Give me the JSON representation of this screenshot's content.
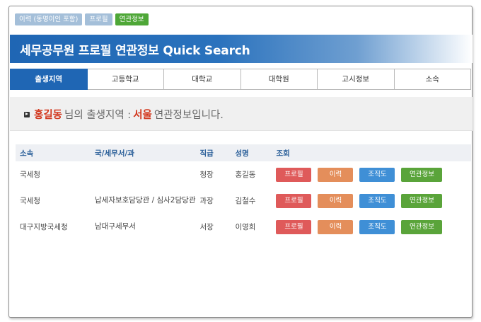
{
  "top_tags": {
    "history": "이력 (동명이인 포함)",
    "profile": "프로필",
    "related": "연관정보"
  },
  "banner": {
    "title": "세무공무원 프로필 연관정보 Quick Search"
  },
  "tabs": [
    {
      "label": "출생지역",
      "active": true
    },
    {
      "label": "고등학교"
    },
    {
      "label": "대학교"
    },
    {
      "label": "대학원"
    },
    {
      "label": "고시정보"
    },
    {
      "label": "소속"
    }
  ],
  "intro": {
    "name": "홍길동",
    "text1": "님의 출생지역 :",
    "region": "서울",
    "text2": "연관정보입니다."
  },
  "table": {
    "headers": [
      "소속",
      "국/세무서/과",
      "직급",
      "성명",
      "조회"
    ],
    "buttons": {
      "profile": "프로필",
      "history": "이력",
      "org": "조직도",
      "related": "연관정보"
    },
    "rows": [
      {
        "affiliation": "국세청",
        "department": "",
        "rank": "청장",
        "name": "홍길동"
      },
      {
        "affiliation": "국세청",
        "department": "납세자보호담당관 / 심사2담당관",
        "rank": "과장",
        "name": "김철수"
      },
      {
        "affiliation": "대구지방국세청",
        "department": "남대구세무서",
        "rank": "서장",
        "name": "이영희"
      }
    ]
  },
  "colors": {
    "brand_blue": "#1f66b4",
    "profile_red": "#df5a5a",
    "history_orange": "#e48e5b",
    "org_blue": "#3f8fd6",
    "related_green": "#5aa43a",
    "highlight_red": "#d2371d"
  }
}
